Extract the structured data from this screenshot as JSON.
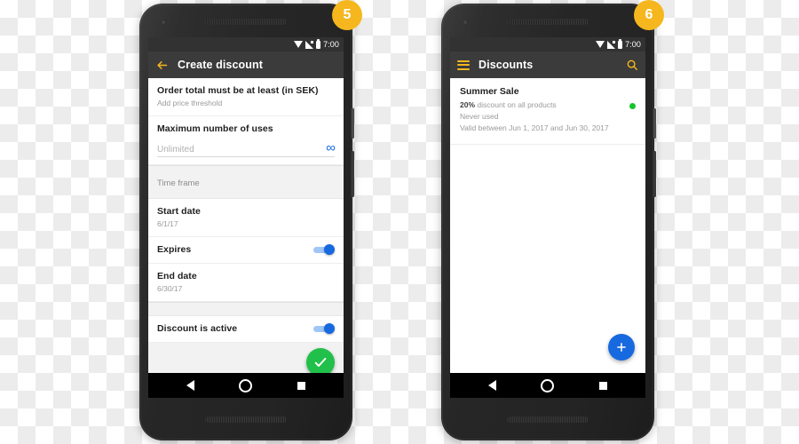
{
  "phones": [
    {
      "badge": "5",
      "statusbar": {
        "time": "7:00",
        "icons": [
          "wifi-icon",
          "signal-icon",
          "battery-icon"
        ]
      },
      "appbar": {
        "nav_icon": "back-arrow-icon",
        "title": "Create discount",
        "nav_icon_color": "#f5b71d"
      },
      "form": {
        "order_total": {
          "title": "Order total must be at least (in SEK)",
          "subtitle": "Add price threshold"
        },
        "max_uses": {
          "title": "Maximum number of uses",
          "placeholder": "Unlimited",
          "value": "",
          "trailing_icon": "infinity-icon"
        },
        "section_time_frame": "Time frame",
        "start_date": {
          "title": "Start date",
          "value": "6/1/17"
        },
        "expires": {
          "title": "Expires",
          "state": "on"
        },
        "end_date": {
          "title": "End date",
          "value": "6/30/17"
        },
        "discount_active": {
          "title": "Discount is active",
          "state": "on"
        },
        "submit": {
          "icon": "check-icon",
          "color": "#21c04a"
        }
      },
      "navbar": {
        "back": "back-triangle-icon",
        "home": "home-circle-icon",
        "recents": "recents-square-icon"
      }
    },
    {
      "badge": "6",
      "statusbar": {
        "time": "7:00",
        "icons": [
          "wifi-icon",
          "signal-icon",
          "battery-icon"
        ]
      },
      "appbar": {
        "nav_icon": "hamburger-menu-icon",
        "title": "Discounts",
        "action_icon": "search-icon",
        "nav_icon_color": "#f5b71d"
      },
      "list": {
        "items": [
          {
            "title": "Summer Sale",
            "discount_value": "20%",
            "discount_text": " discount on all products",
            "usage": "Never used",
            "validity": "Valid between Jun 1, 2017 and Jun 30, 2017",
            "status_color": "#17c42c"
          }
        ],
        "fab": {
          "icon": "plus-icon",
          "color": "#1769e0"
        }
      },
      "navbar": {
        "back": "back-triangle-icon",
        "home": "home-circle-icon",
        "recents": "recents-square-icon"
      }
    }
  ],
  "theme": {
    "accent_yellow": "#f5b71d",
    "accent_blue": "#1769e0",
    "accent_green": "#21c04a",
    "appbar_bg": "#3b3b3b",
    "statusbar_bg": "#323232"
  }
}
